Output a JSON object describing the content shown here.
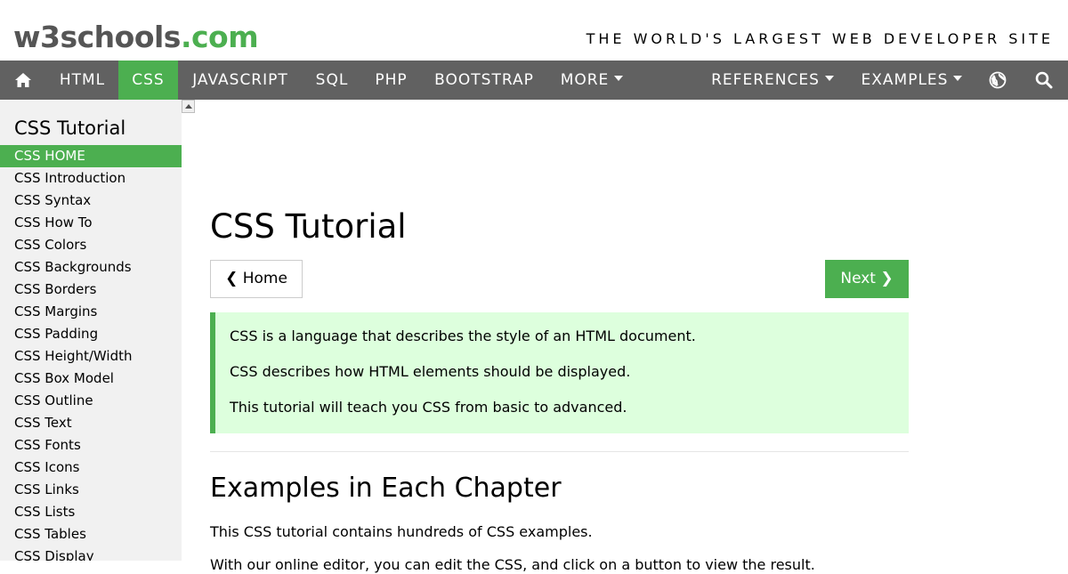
{
  "header": {
    "logo_part1": "w3schools",
    "logo_part2": ".com",
    "tagline": "THE WORLD'S LARGEST WEB DEVELOPER SITE"
  },
  "topnav": {
    "items": [
      {
        "label": "HTML"
      },
      {
        "label": "CSS",
        "active": true
      },
      {
        "label": "JAVASCRIPT"
      },
      {
        "label": "SQL"
      },
      {
        "label": "PHP"
      },
      {
        "label": "BOOTSTRAP"
      },
      {
        "label": "MORE"
      },
      {
        "label": "REFERENCES"
      },
      {
        "label": "EXAMPLES"
      }
    ],
    "icons": [
      "home-icon",
      "globe-icon",
      "search-icon"
    ]
  },
  "sidebar": {
    "title": "CSS Tutorial",
    "items": [
      {
        "label": "CSS HOME",
        "active": true
      },
      {
        "label": "CSS Introduction"
      },
      {
        "label": "CSS Syntax"
      },
      {
        "label": "CSS How To"
      },
      {
        "label": "CSS Colors"
      },
      {
        "label": "CSS Backgrounds"
      },
      {
        "label": "CSS Borders"
      },
      {
        "label": "CSS Margins"
      },
      {
        "label": "CSS Padding"
      },
      {
        "label": "CSS Height/Width"
      },
      {
        "label": "CSS Box Model"
      },
      {
        "label": "CSS Outline"
      },
      {
        "label": "CSS Text"
      },
      {
        "label": "CSS Fonts"
      },
      {
        "label": "CSS Icons"
      },
      {
        "label": "CSS Links"
      },
      {
        "label": "CSS Lists"
      },
      {
        "label": "CSS Tables"
      },
      {
        "label": "CSS Display"
      }
    ]
  },
  "main": {
    "title": "CSS Tutorial",
    "home_button": "❮ Home",
    "next_button": "Next ❯",
    "note": [
      "CSS is a language that describes the style of an HTML document.",
      "CSS describes how HTML elements should be displayed.",
      "This tutorial will teach you CSS from basic to advanced."
    ],
    "section_title": "Examples in Each Chapter",
    "section_text": "This CSS tutorial contains hundreds of CSS examples.",
    "section_text2": "With our online editor, you can edit the CSS, and click on a button to view the result."
  },
  "colors": {
    "brand_green": "#4caf50",
    "nav_gray": "#616161",
    "sidebar_bg": "#f1f1f1",
    "note_bg": "#ddffdd"
  }
}
